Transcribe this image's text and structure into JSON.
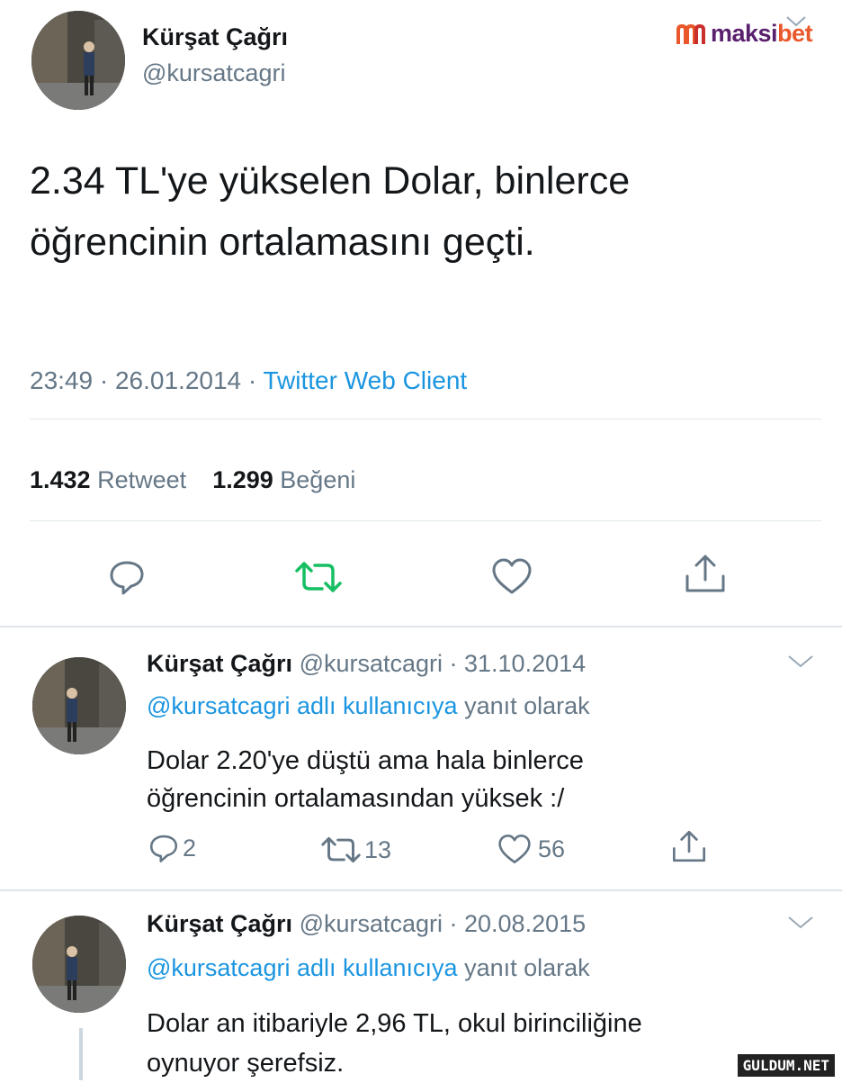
{
  "brand": {
    "logo_text": "maksibet",
    "colors": {
      "accent": "#e9572b"
    }
  },
  "main_tweet": {
    "author_name": "Kürşat Çağrı",
    "author_handle": "@kursatcagri",
    "text_line1": "2.34 TL'ye yükselen Dolar, binlerce",
    "text_line2": "öğrencinin ortalamasını geçti.",
    "time": "23:49",
    "date": "26.01.2014",
    "client": "Twitter Web Client",
    "sep": "·",
    "retweet_count": "1.432",
    "retweet_label": "Retweet",
    "like_count": "1.299",
    "like_label": "Beğeni"
  },
  "replies": [
    {
      "author_name": "Kürşat Çağrı",
      "meta": "@kursatcagri · 31.10.2014",
      "reply_mention": "@kursatcagri adlı kullanıcıya",
      "reply_suffix": "yanıt olarak",
      "text_line1": "Dolar 2.20'ye düştü ama hala binlerce",
      "text_line2": "öğrencinin ortalamasından yüksek :/",
      "reply_count": "2",
      "retweet_count": "13",
      "like_count": "56"
    },
    {
      "author_name": "Kürşat Çağrı",
      "meta": "@kursatcagri · 20.08.2015",
      "reply_mention": "@kursatcagri adlı kullanıcıya",
      "reply_suffix": "yanıt olarak",
      "text_line1": "Dolar an itibariyle 2,96 TL, okul birinciliğine",
      "text_line2": "oynuyor şerefsiz."
    }
  ],
  "watermark": "GULDUM.NET",
  "icons": [
    "reply-icon",
    "retweet-icon",
    "like-icon",
    "share-icon",
    "chevron-down-icon"
  ]
}
